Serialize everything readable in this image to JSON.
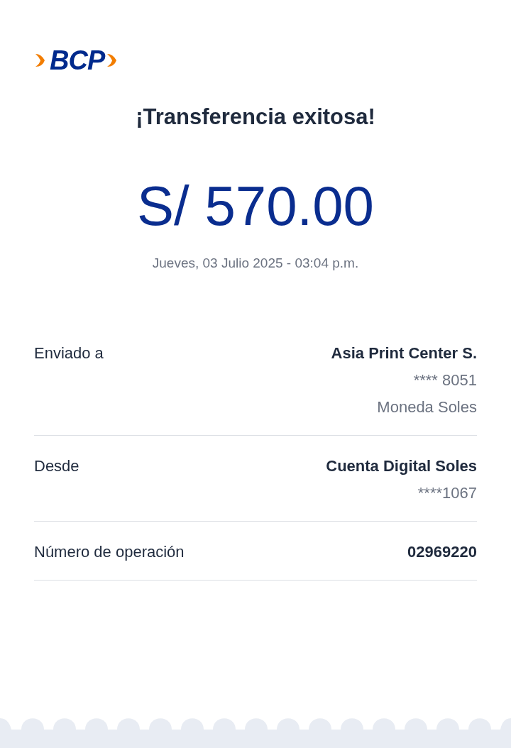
{
  "logo": {
    "text": "BCP"
  },
  "title": "¡Transferencia exitosa!",
  "amount": "S/ 570.00",
  "datetime": "Jueves, 03 Julio 2025 - 03:04 p.m.",
  "details": [
    {
      "label": "Enviado a",
      "values": [
        {
          "text": "Asia Print Center S.",
          "kind": "primary"
        },
        {
          "text": "**** 8051",
          "kind": "secondary"
        },
        {
          "text": "Moneda Soles",
          "kind": "secondary"
        }
      ]
    },
    {
      "label": "Desde",
      "values": [
        {
          "text": "Cuenta Digital Soles",
          "kind": "primary"
        },
        {
          "text": "****1067",
          "kind": "secondary"
        }
      ]
    },
    {
      "label": "Número de operación",
      "values": [
        {
          "text": "02969220",
          "kind": "primary"
        }
      ]
    }
  ]
}
